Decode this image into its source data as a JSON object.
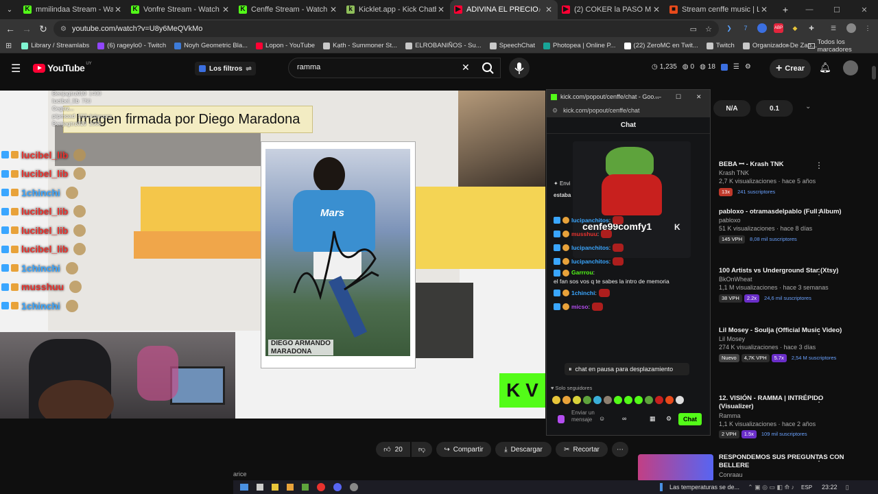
{
  "tabs": [
    {
      "title": "mmilindaa Stream - Watch L",
      "color": "#53fc18",
      "icon": "K"
    },
    {
      "title": "Vonfre Stream - Watch Live",
      "color": "#53fc18",
      "icon": "K"
    },
    {
      "title": "Cenffe Stream - Watch Live on",
      "color": "#53fc18",
      "icon": "K"
    },
    {
      "title": "Kicklet.app - Kick Chatbot and",
      "color": "#8fbf5a",
      "icon": "k"
    },
    {
      "title": "ADIVINA EL PRECIO ft el chat",
      "color": "#ff0033",
      "icon": "▶"
    },
    {
      "title": "(2) COKER la PASÓ MUY MAL c",
      "color": "#ff0033",
      "icon": "▶"
    },
    {
      "title": "Stream cenffe music | Listen to",
      "color": "#e84a1b",
      "icon": "■"
    }
  ],
  "address": {
    "url": "youtube.com/watch?v=U8y6MeQVkMo"
  },
  "bookmarks": [
    {
      "label": "Library / Streamlabs",
      "color": "#80f5d2"
    },
    {
      "label": "(6) rageylo0 - Twitch",
      "color": "#9146ff"
    },
    {
      "label": "Noyh Geometric Bla...",
      "color": "#3d7bd9"
    },
    {
      "label": "Lopon - YouTube",
      "color": "#ff0033"
    },
    {
      "label": "Kạth - Summoner St...",
      "color": "#c8c8c8"
    },
    {
      "label": "ELROBANIÑOS - Su...",
      "color": "#c8c8c8"
    },
    {
      "label": "SpeechChat",
      "color": "#c8c8c8"
    },
    {
      "label": "Photopea | Online P...",
      "color": "#18a497"
    },
    {
      "label": "(22) ZeroMC en Twit...",
      "color": "#ffffff"
    },
    {
      "label": "Twitch",
      "color": "#c8c8c8"
    },
    {
      "label": "Organizador De Zap...",
      "color": "#c8c8c8"
    }
  ],
  "bookmarks_all": "Todos los marcadores",
  "youtube": {
    "logo": "YouTube",
    "country": "UY",
    "filters": "Los filtros",
    "search_value": "ramma",
    "stats": {
      "a": "1,235",
      "b": "0",
      "c": "18"
    },
    "create": "Crear"
  },
  "video": {
    "caption": "Imagen firmada por Diego Maradona",
    "card_name_line1": "DIEGO ARMANDO",
    "card_name_line2": "MARADONA",
    "card_jersey": "Mars",
    "kick_letters": "K V",
    "donations": [
      {
        "name": "Benjagtrz010",
        "amount": "1400"
      },
      {
        "name": "lucibel_lib",
        "amount": "750"
      },
      {
        "name": "Cegtrz...",
        "amount": ""
      },
      {
        "name": "pipmoad",
        "amount": "500 dolaruccs"
      },
      {
        "name": "Benjagtrz010",
        "amount": "1500"
      }
    ],
    "overlay_chat": [
      {
        "user": "lucibel_lib",
        "color": "#e8322e"
      },
      {
        "user": "lucibel_lib",
        "color": "#e8322e"
      },
      {
        "user": "1chinchi",
        "color": "#3aa6ff"
      },
      {
        "user": "lucibel_lib",
        "color": "#e8322e"
      },
      {
        "user": "lucibel_lib",
        "color": "#e8322e"
      },
      {
        "user": "lucibel_lib",
        "color": "#e8322e"
      },
      {
        "user": "1chinchi",
        "color": "#3aa6ff"
      },
      {
        "user": "musshuu",
        "color": "#e8322e"
      },
      {
        "user": "1chinchi",
        "color": "#3aa6ff"
      }
    ]
  },
  "kick_popup": {
    "window_title": "kick.com/popout/cenffe/chat - Goo...",
    "url": "kick.com/popout/cenffe/chat",
    "header": "Chat",
    "pinned_label": "Envi",
    "pinned_text": "estaba",
    "profile_name": "cenfe99comfy1",
    "messages": [
      {
        "user": "lucipanchitos",
        "text": "",
        "color": "#3aa6ff"
      },
      {
        "user": "musshuu",
        "text": "",
        "color": "#e8322e"
      },
      {
        "user": "lucipanchitos",
        "text": "",
        "color": "#3aa6ff"
      },
      {
        "user": "lucipanchitos",
        "text": "",
        "color": "#3aa6ff"
      },
      {
        "user": "Garrrou",
        "text": "el fan sos vos q te sabes la intro de memoria",
        "color": "#53fc18"
      },
      {
        "user": "1chinchi",
        "text": "",
        "color": "#3aa6ff"
      },
      {
        "user": "micso",
        "text": "",
        "color": "#b44df0"
      }
    ],
    "paused": "chat en pausa para desplazamiento",
    "followers_only": "Solo seguidores",
    "send_placeholder": "Enviar un mensaje",
    "chat_button": "Chat"
  },
  "right_pills": {
    "a": "N/A",
    "b": "0.1"
  },
  "recommendations": [
    {
      "title": "BEBA ꟷ - Krash TNK",
      "channel": "Krash TNK",
      "meta": "2,7 K visualizaciones · hace 5 años",
      "pills": [
        "13x",
        "241 suscriptores"
      ]
    },
    {
      "title": "pabloxo - otramasdelpablo (Full Album)",
      "channel": "pabloxo",
      "meta": "51 K visualizaciones · hace 8 días",
      "pills": [
        "145 VPH",
        "8,08 mil suscriptores"
      ]
    },
    {
      "title": "100 Artists vs Underground Star (Xtsy)",
      "channel": "BkOnWheat",
      "meta": "1,1 M visualizaciones · hace 3 semanas",
      "pills": [
        "38 VPH",
        "2.2x",
        "24,6 mil suscriptores"
      ]
    },
    {
      "title": "Lil Mosey - Soulja (Official Music Video)",
      "channel": "Lil Mosey",
      "meta": "274 K visualizaciones · hace 3 días",
      "pills": [
        "Nuevo",
        "4,7K VPH",
        "5.7x",
        "2,54 M suscriptores"
      ]
    },
    {
      "title": "12. VISIÓN - RAMMA | INTRÉPIDO (Visualizer)",
      "channel": "Ramma",
      "meta": "1,1 K visualizaciones · hace 2 años",
      "pills": [
        "2 VPH",
        "1.5x",
        "109 mil suscriptores"
      ]
    },
    {
      "title": "RESPONDEMOS SUS PREGUNTAS CON BELLERE",
      "channel": "Conraau",
      "meta": "",
      "pills": []
    }
  ],
  "actions": {
    "likes": "20",
    "share": "Compartir",
    "download": "Descargar",
    "clip": "Recortar"
  },
  "taskbar": {
    "weather": "Las temperaturas se de...",
    "lang": "ESP",
    "time": "23:22",
    "partial": "arice"
  }
}
